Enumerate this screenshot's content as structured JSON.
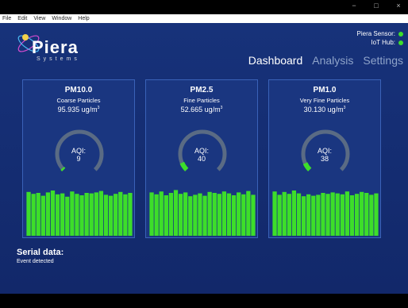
{
  "window": {
    "controls": [
      "−",
      "□",
      "×"
    ]
  },
  "menu": [
    "File",
    "Edit",
    "View",
    "Window",
    "Help"
  ],
  "logo": {
    "name": "Piera",
    "sub": "Systems"
  },
  "status": {
    "sensor_label": "Piera Sensor:",
    "hub_label": "IoT Hub:",
    "sensor_color": "#3dde2a",
    "hub_color": "#3dde2a"
  },
  "nav": {
    "items": [
      "Dashboard",
      "Analysis",
      "Settings"
    ],
    "active": "Dashboard"
  },
  "panels": [
    {
      "name": "PM10.0",
      "sub": "Coarse Particles",
      "value": "95.935",
      "unit": "ug/m",
      "unit_sup": "3",
      "aqi_label": "AQI:",
      "aqi": "9",
      "aqi_num": 9,
      "bars": [
        92,
        88,
        90,
        84,
        91,
        95,
        87,
        89,
        82,
        93,
        88,
        85,
        90,
        89,
        91,
        94,
        86,
        84,
        88,
        92,
        87,
        90
      ]
    },
    {
      "name": "PM2.5",
      "sub": "Fine Particles",
      "value": "52.665",
      "unit": "ug/m",
      "unit_sup": "3",
      "aqi_label": "AQI:",
      "aqi": "40",
      "aqi_num": 40,
      "bars": [
        91,
        87,
        93,
        85,
        90,
        96,
        88,
        91,
        83,
        86,
        89,
        84,
        92,
        90,
        88,
        93,
        89,
        85,
        91,
        87,
        94,
        86
      ]
    },
    {
      "name": "PM1.0",
      "sub": "Very Fine Particles",
      "value": "30.130",
      "unit": "ug/m",
      "unit_sup": "3",
      "aqi_label": "AQI:",
      "aqi": "38",
      "aqi_num": 38,
      "bars": [
        93,
        86,
        92,
        88,
        95,
        89,
        83,
        87,
        84,
        86,
        90,
        88,
        91,
        89,
        87,
        93,
        85,
        88,
        92,
        90,
        86,
        89
      ]
    }
  ],
  "serial": {
    "title": "Serial data:",
    "text": "Event detected"
  },
  "colors": {
    "accent_green": "#3dde2a",
    "gauge_track": "#5a6b84"
  }
}
